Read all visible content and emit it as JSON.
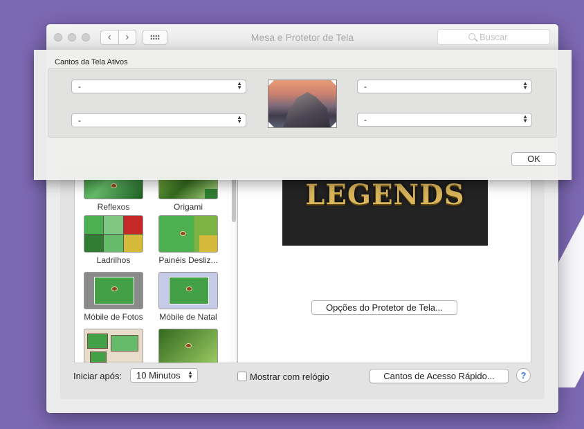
{
  "window": {
    "title": "Mesa e Protetor de Tela",
    "search_placeholder": "Buscar"
  },
  "nav": {
    "back_icon": "chevron-left-icon",
    "forward_icon": "chevron-right-icon",
    "show_all_icon": "grid-icon"
  },
  "screensavers": [
    {
      "label": "Reflexos"
    },
    {
      "label": "Origami"
    },
    {
      "label": "Ladrilhos"
    },
    {
      "label": "Painéis Desliz..."
    },
    {
      "label": "Móbile de Fotos"
    },
    {
      "label": "Móbile de Natal"
    }
  ],
  "preview": {
    "title_text": "LEGENDS",
    "options_button": "Opções do Protetor de Tela..."
  },
  "bottom": {
    "start_after_label": "Iniciar após:",
    "start_after_value": "10 Minutos",
    "show_clock_label": "Mostrar com relógio",
    "show_clock_checked": false,
    "hot_corners_button": "Cantos de Acesso Rápido...",
    "help_label": "?"
  },
  "sheet": {
    "group_label": "Cantos da Tela Ativos",
    "top_left": "-",
    "top_right": "-",
    "bottom_left": "-",
    "bottom_right": "-",
    "ok_button": "OK"
  }
}
